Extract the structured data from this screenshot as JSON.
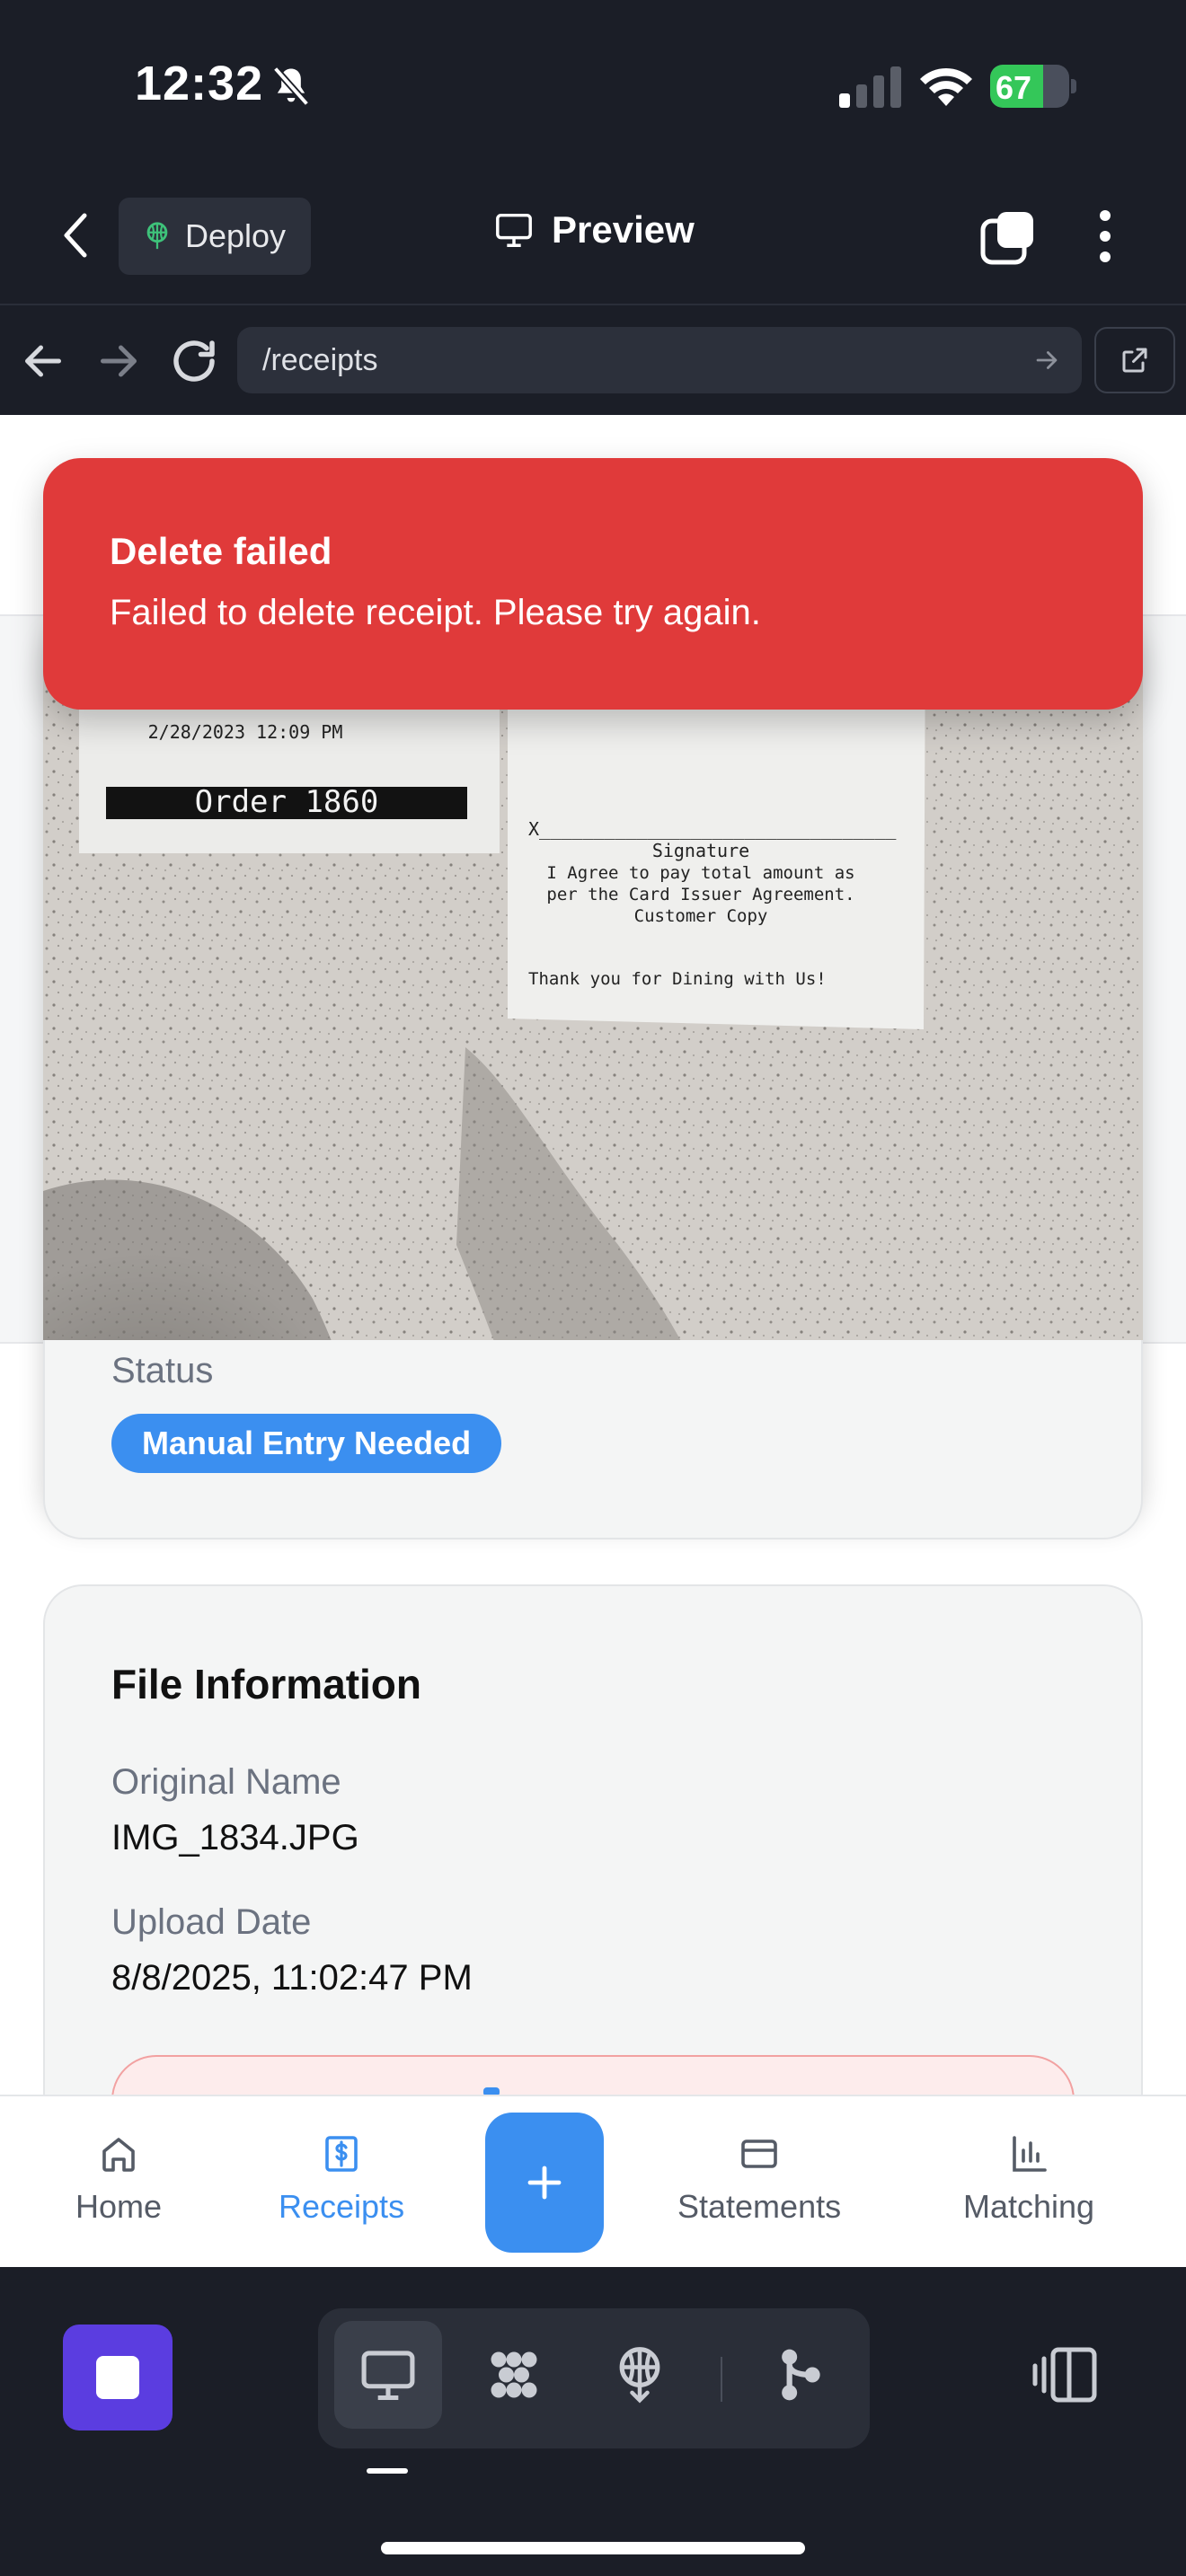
{
  "status_bar": {
    "time": "12:32",
    "battery": "67",
    "battery_level": 0.67
  },
  "header": {
    "deploy_label": "Deploy",
    "preview_label": "Preview"
  },
  "browser": {
    "url": "/receipts"
  },
  "toast": {
    "title": "Delete failed",
    "message": "Failed to delete receipt. Please try again."
  },
  "receipt_image": {
    "date_text": "2/28/2023 12:09 PM",
    "order_text": "Order 1860",
    "signature_line": "X_________________________________",
    "signature_label": "Signature",
    "agreement_1": "I Agree to pay total amount as",
    "agreement_2": "per the Card Issuer Agreement.",
    "copy_label": "Customer Copy",
    "thanks": "Thank you for Dining with Us!"
  },
  "status": {
    "label": "Status",
    "badge": "Manual Entry Needed"
  },
  "file_info": {
    "title": "File Information",
    "original_name_label": "Original Name",
    "original_name": "IMG_1834.JPG",
    "upload_date_label": "Upload Date",
    "upload_date": "8/8/2025, 11:02:47 PM"
  },
  "bottom_nav": {
    "home": "Home",
    "receipts": "Receipts",
    "statements": "Statements",
    "matching": "Matching"
  },
  "colors": {
    "accent": "#3b8ff0",
    "toast_bg": "#e03a3a",
    "dark_bg": "#1b1e27",
    "stop_btn": "#5b3de0"
  }
}
